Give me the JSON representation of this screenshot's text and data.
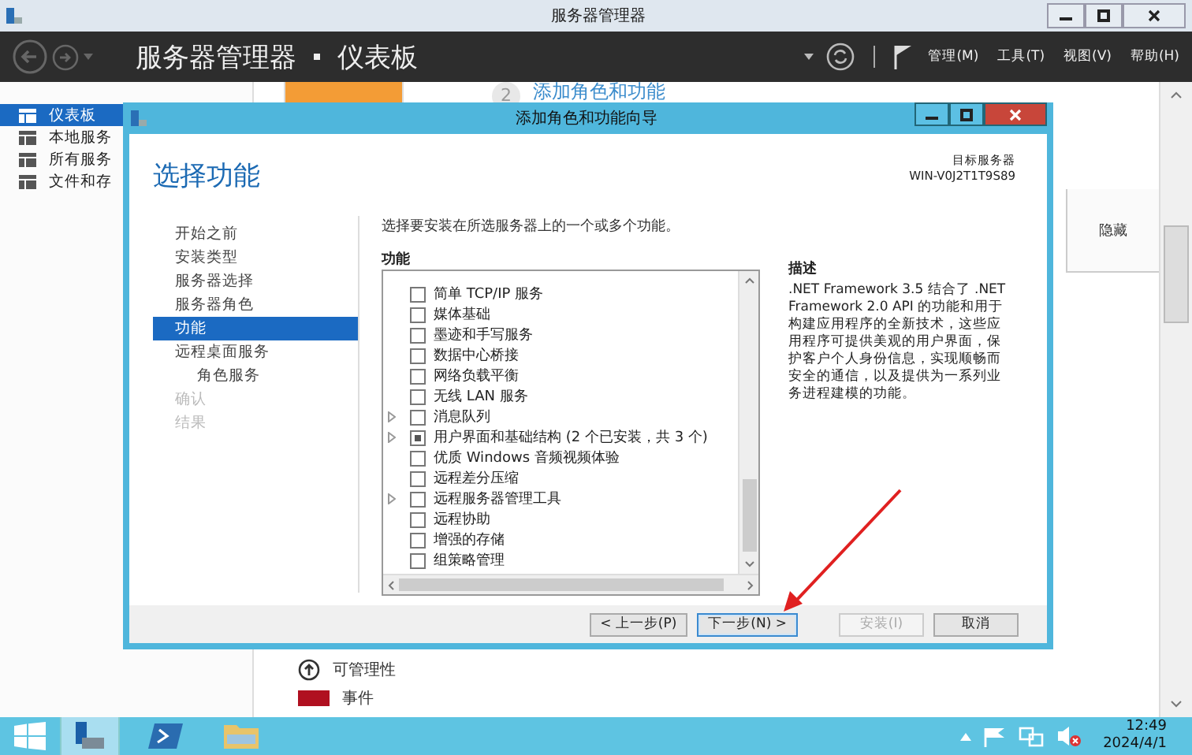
{
  "window": {
    "title": "服务器管理器"
  },
  "header": {
    "breadcrumb": [
      "服务器管理器",
      "仪表板"
    ],
    "menus": [
      "管理(M)",
      "工具(T)",
      "视图(V)",
      "帮助(H)"
    ]
  },
  "sidebar": {
    "items": [
      {
        "label": "仪表板",
        "selected": true
      },
      {
        "label": "本地服务",
        "selected": false
      },
      {
        "label": "所有服务",
        "selected": false
      },
      {
        "label": "文件和存",
        "selected": false
      }
    ]
  },
  "dashboard": {
    "step_number": "2",
    "step_link": "添加角色和功能",
    "hide_button": "隐藏",
    "tiles": [
      {
        "label": "可管理性",
        "kind": "status"
      },
      {
        "label": "事件",
        "kind": "alert"
      }
    ]
  },
  "dialog": {
    "title": "添加角色和功能向导",
    "heading": "选择功能",
    "target_label": "目标服务器",
    "target_server": "WIN-V0J2T1T9S89",
    "steps": [
      {
        "label": "开始之前",
        "selected": false,
        "disabled": false
      },
      {
        "label": "安装类型",
        "selected": false,
        "disabled": false
      },
      {
        "label": "服务器选择",
        "selected": false,
        "disabled": false
      },
      {
        "label": "服务器角色",
        "selected": false,
        "disabled": false
      },
      {
        "label": "功能",
        "selected": true,
        "disabled": false
      },
      {
        "label": "远程桌面服务",
        "selected": false,
        "disabled": false,
        "children": [
          {
            "label": "角色服务",
            "selected": false,
            "disabled": false
          }
        ]
      },
      {
        "label": "确认",
        "selected": false,
        "disabled": true
      },
      {
        "label": "结果",
        "selected": false,
        "disabled": true
      }
    ],
    "instruction": "选择要安装在所选服务器上的一个或多个功能。",
    "features_heading": "功能",
    "features": [
      {
        "label": "简单 TCP/IP 服务",
        "indeterminate": false,
        "expandable": false
      },
      {
        "label": "媒体基础",
        "indeterminate": false,
        "expandable": false
      },
      {
        "label": "墨迹和手写服务",
        "indeterminate": false,
        "expandable": false
      },
      {
        "label": "数据中心桥接",
        "indeterminate": false,
        "expandable": false
      },
      {
        "label": "网络负载平衡",
        "indeterminate": false,
        "expandable": false
      },
      {
        "label": "无线 LAN 服务",
        "indeterminate": false,
        "expandable": false
      },
      {
        "label": "消息队列",
        "indeterminate": false,
        "expandable": true
      },
      {
        "label": "用户界面和基础结构 (2 个已安装，共 3 个)",
        "indeterminate": true,
        "expandable": true
      },
      {
        "label": "优质 Windows 音频视频体验",
        "indeterminate": false,
        "expandable": false
      },
      {
        "label": "远程差分压缩",
        "indeterminate": false,
        "expandable": false
      },
      {
        "label": "远程服务器管理工具",
        "indeterminate": false,
        "expandable": true
      },
      {
        "label": "远程协助",
        "indeterminate": false,
        "expandable": false
      },
      {
        "label": "增强的存储",
        "indeterminate": false,
        "expandable": false
      },
      {
        "label": "组策略管理",
        "indeterminate": false,
        "expandable": false
      }
    ],
    "description_heading": "描述",
    "description": ".NET Framework 3.5 结合了 .NET Framework 2.0 API 的功能和用于构建应用程序的全新技术，这些应用程序可提供美观的用户界面，保护客户个人身份信息，实现顺畅而安全的通信，以及提供为一系列业务进程建模的功能。",
    "buttons": [
      {
        "label": "< 上一步(P)",
        "disabled": false,
        "default": false
      },
      {
        "label": "下一步(N) >",
        "disabled": false,
        "default": true
      },
      {
        "label": "安装(I)",
        "disabled": true,
        "default": false
      },
      {
        "label": "取消",
        "disabled": false,
        "default": false
      }
    ]
  },
  "taskbar": {
    "time": "12:49",
    "date": "2024/4/1"
  }
}
